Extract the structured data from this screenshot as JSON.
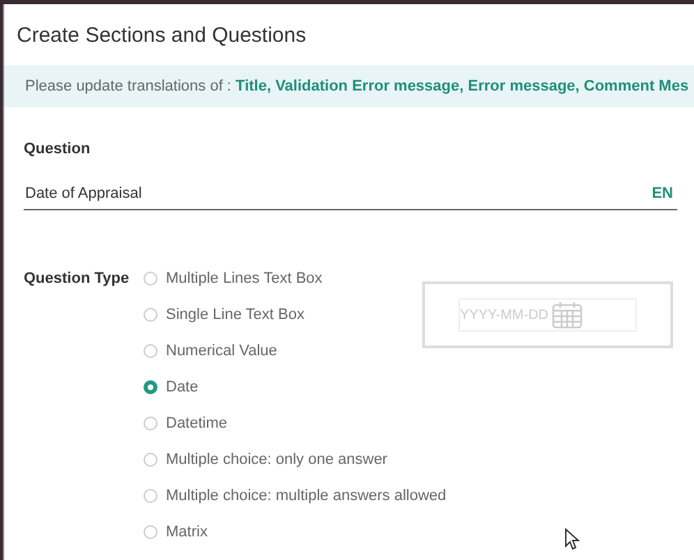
{
  "dialog": {
    "title": "Create Sections and Questions"
  },
  "banner": {
    "prefix": "Please update translations of : ",
    "fields": "Title, Validation Error message, Error message, Comment Mes"
  },
  "question": {
    "label": "Question",
    "value": "Date of Appraisal",
    "language": "EN"
  },
  "question_type": {
    "label": "Question Type",
    "options": [
      {
        "label": "Multiple Lines Text Box",
        "selected": false
      },
      {
        "label": "Single Line Text Box",
        "selected": false
      },
      {
        "label": "Numerical Value",
        "selected": false
      },
      {
        "label": "Date",
        "selected": true
      },
      {
        "label": "Datetime",
        "selected": false
      },
      {
        "label": "Multiple choice: only one answer",
        "selected": false
      },
      {
        "label": "Multiple choice: multiple answers allowed",
        "selected": false
      },
      {
        "label": "Matrix",
        "selected": false
      }
    ]
  },
  "preview": {
    "placeholder": "YYYY-MM-DD"
  }
}
